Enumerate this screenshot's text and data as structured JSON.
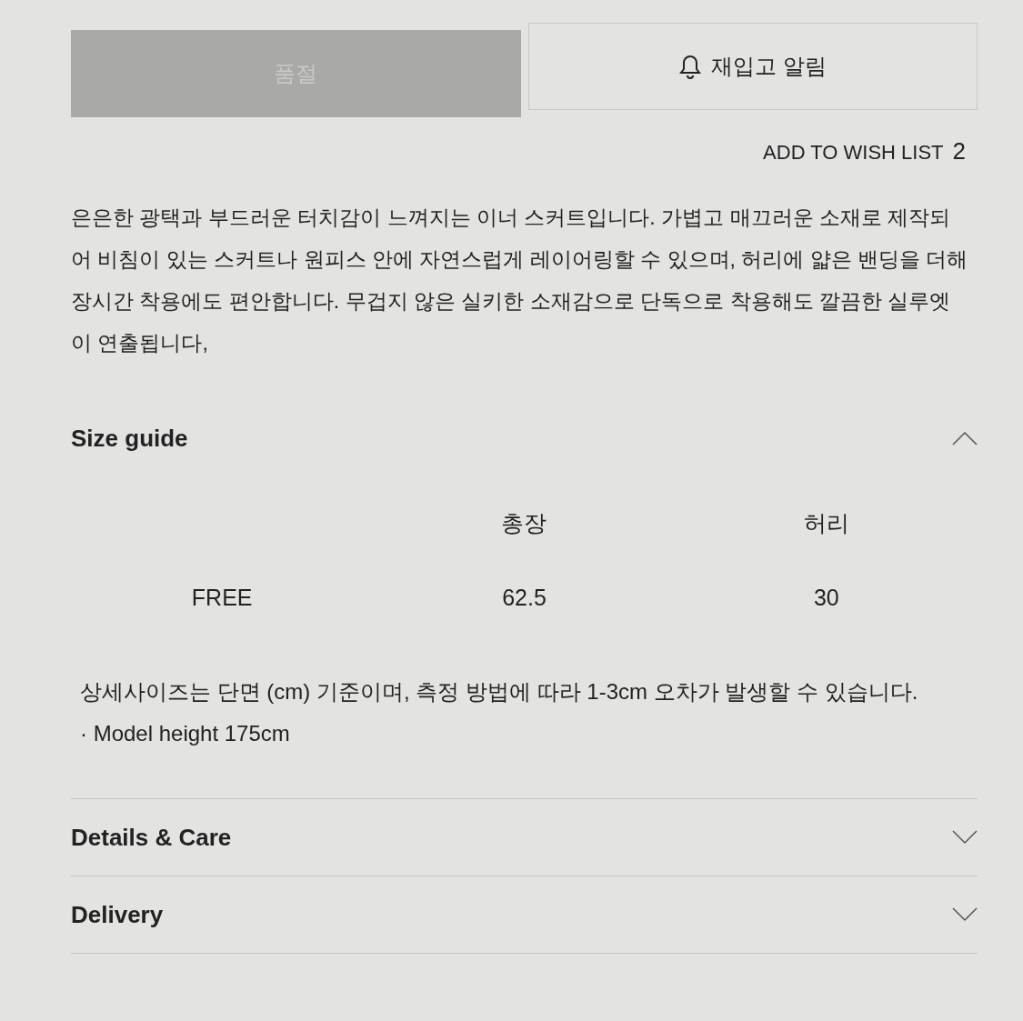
{
  "buttons": [
    {
      "label": "품절",
      "kind": "soldout",
      "disabled": true
    },
    {
      "label": "재입고 알림",
      "kind": "restock",
      "disabled": false
    }
  ],
  "wishlist": {
    "label": "ADD TO WISH LIST",
    "count": "2"
  },
  "description": "은은한 광택과 부드러운 터치감이 느껴지는 이너 스커트입니다. 가볍고 매끄러운 소재로 제작되어 비침이 있는 스커트나 원피스 안에 자연스럽게 레이어링할 수 있으며, 허리에 얇은 밴딩을 더해 장시간 착용에도 편안합니다. 무겁지 않은 실키한 소재감으로 단독으로 착용해도 깔끔한 실루엣이 연출됩니다,",
  "accordions": [
    {
      "title": "Size guide",
      "expanded": true,
      "columns": [
        "총장",
        "허리"
      ],
      "rows": [
        {
          "size": "FREE",
          "values": [
            "62.5",
            "30"
          ]
        }
      ],
      "notes": [
        "상세사이즈는 단면 (cm) 기준이며, 측정 방법에 따라 1-3cm 오차가 발생할 수 있습니다.",
        "· Model height 175cm"
      ]
    },
    {
      "title": "Details & Care",
      "expanded": false
    },
    {
      "title": "Delivery",
      "expanded": false
    }
  ]
}
